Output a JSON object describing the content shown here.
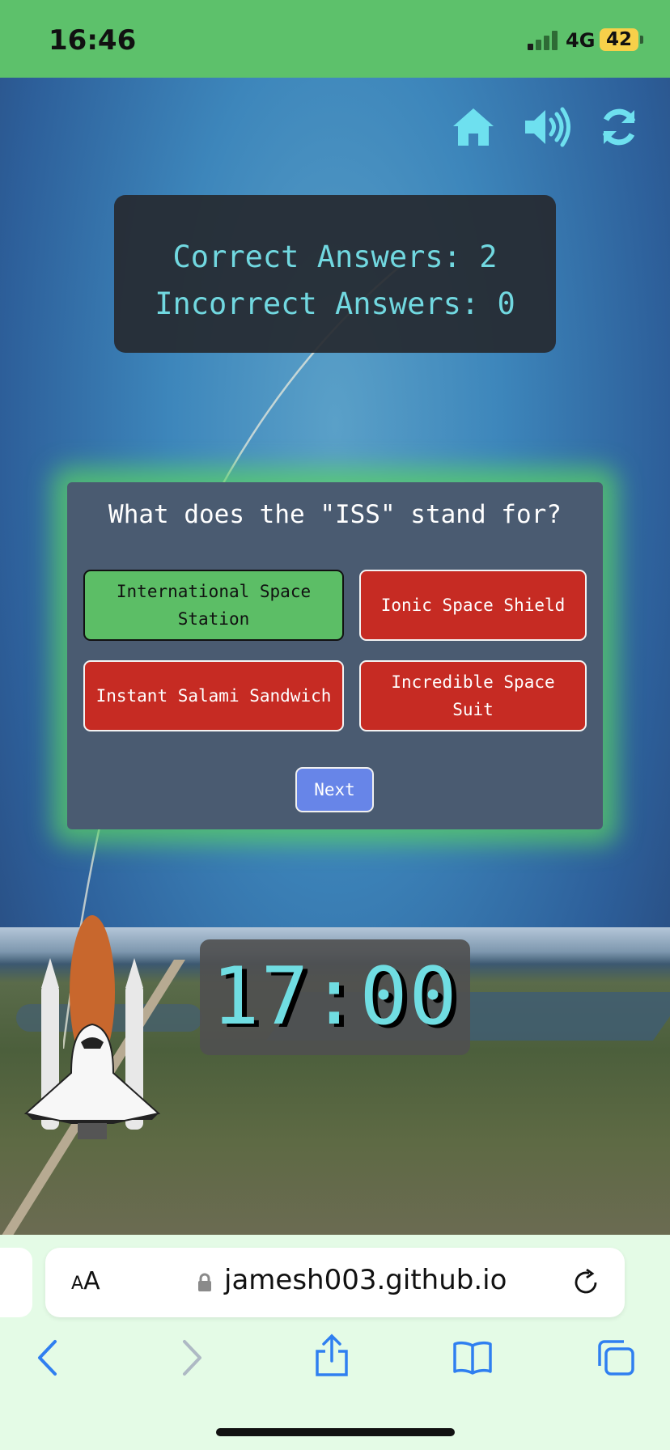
{
  "status_bar": {
    "time": "16:46",
    "network": "4G",
    "battery": "42"
  },
  "toolbar": {
    "icons": [
      "home-icon",
      "volume-icon",
      "restart-icon"
    ],
    "accent_color": "#6ee0ef"
  },
  "score": {
    "correct_label": "Correct Answers: 2",
    "incorrect_label": "Incorrect Answers: 0"
  },
  "quiz": {
    "question": "What does the \"ISS\" stand for?",
    "answers": [
      {
        "label": "International Space Station",
        "state": "correct",
        "color": "#5cbe66"
      },
      {
        "label": "Ionic Space Shield",
        "state": "incorrect",
        "color": "#c62b23"
      },
      {
        "label": "Instant Salami Sandwich",
        "state": "incorrect",
        "color": "#c62b23"
      },
      {
        "label": "Incredible Space Suit",
        "state": "incorrect",
        "color": "#c62b23"
      }
    ],
    "next_label": "Next",
    "next_color": "#6785e8"
  },
  "timer": {
    "value": "17:00"
  },
  "browser": {
    "text_size_label": "AA",
    "url": "jamesh003.github.io"
  }
}
